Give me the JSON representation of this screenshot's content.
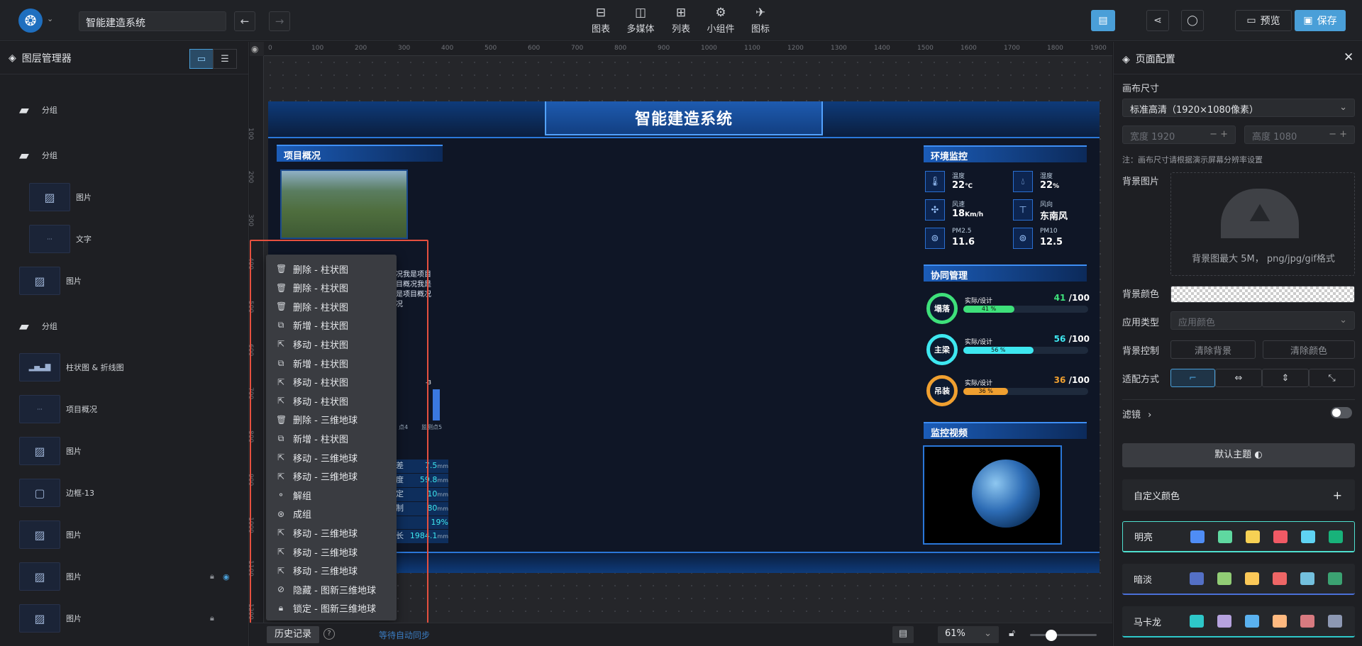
{
  "topbar": {
    "project_title": "智能建造系统",
    "back_icon": "←",
    "forward_icon": "→",
    "tools": [
      {
        "label": "图表",
        "icon": "chart-icon"
      },
      {
        "label": "多媒体",
        "icon": "media-icon"
      },
      {
        "label": "列表",
        "icon": "table-icon"
      },
      {
        "label": "小组件",
        "icon": "widget-icon"
      },
      {
        "label": "图标",
        "icon": "plane-icon"
      }
    ],
    "preview_label": "预览",
    "save_label": "保存",
    "accent": "#4a9fd8"
  },
  "layers_panel": {
    "title": "图层管理器",
    "items": [
      {
        "label": "分组",
        "type": "folder"
      },
      {
        "label": "分组",
        "type": "folder"
      },
      {
        "label": "图片",
        "type": "image"
      },
      {
        "label": "文字",
        "type": "text"
      },
      {
        "label": "图片",
        "type": "image"
      },
      {
        "label": "分组",
        "type": "folder"
      },
      {
        "label": "柱状图 & 折线图",
        "type": "chart"
      },
      {
        "label": "项目概况",
        "type": "text"
      },
      {
        "label": "图片",
        "type": "image"
      },
      {
        "label": "边框-13",
        "type": "border"
      },
      {
        "label": "图片",
        "type": "image"
      },
      {
        "label": "图片",
        "type": "image"
      },
      {
        "label": "图片",
        "type": "image"
      }
    ]
  },
  "ruler": {
    "h_ticks": [
      "0",
      "100",
      "200",
      "300",
      "400",
      "500",
      "600",
      "700",
      "800",
      "900",
      "1000",
      "1100",
      "1200",
      "1300",
      "1400",
      "1500",
      "1600",
      "1700",
      "1800",
      "1900"
    ],
    "v_ticks": [
      "100",
      "200",
      "300",
      "400",
      "500",
      "600",
      "700",
      "800",
      "900",
      "1000",
      "1100",
      "1200"
    ]
  },
  "dashboard": {
    "title": "智能建造系统",
    "project_panel": {
      "title": "项目概况",
      "text_lines": [
        "况我是项目",
        "目概况我是",
        "是项目概况",
        "况"
      ]
    },
    "env_panel": {
      "title": "环境监控",
      "items": [
        {
          "label": "温度",
          "value": "22",
          "unit": "℃",
          "icon": "thermometer-icon"
        },
        {
          "label": "湿度",
          "value": "22",
          "unit": "%",
          "icon": "droplet-icon"
        },
        {
          "label": "风速",
          "value": "18",
          "unit": "Km/h",
          "icon": "fan-icon"
        },
        {
          "label": "风向",
          "value": "东南风",
          "unit": "",
          "icon": "wind-direction-icon"
        },
        {
          "label": "PM2.5",
          "value": "11.6",
          "unit": "",
          "icon": "pm25-icon"
        },
        {
          "label": "PM10",
          "value": "12.5",
          "unit": "",
          "icon": "pm10-icon"
        }
      ]
    },
    "coop_panel": {
      "title": "协同管理",
      "items": [
        {
          "name": "塌落",
          "label": "实际/设计",
          "actual": "41",
          "total": "/100",
          "percent": 41,
          "pct_text": "41 %",
          "color": "#3ee07a"
        },
        {
          "name": "主梁",
          "label": "实际/设计",
          "actual": "56",
          "total": "/100",
          "percent": 56,
          "pct_text": "56 %",
          "color": "#3ee7f0"
        },
        {
          "name": "吊装",
          "label": "实际/设计",
          "actual": "36",
          "total": "/100",
          "percent": 36,
          "pct_text": "36 %",
          "color": "#f0a030"
        }
      ]
    },
    "video_panel": {
      "title": "监控视频"
    },
    "left_values": [
      "7.5",
      "59.8",
      "10",
      "80",
      "19%",
      "1984.1"
    ],
    "left_units": [
      "mm",
      "mm",
      "mm",
      "mm",
      "",
      "mm"
    ],
    "left_partial_labels": [
      "差",
      "度",
      "定",
      "制",
      "",
      "长"
    ],
    "chart_labels": [
      "-3",
      "点4",
      "监测点5"
    ]
  },
  "history": {
    "items": [
      {
        "label": "删除 - 柱状图",
        "icon": "trash-icon"
      },
      {
        "label": "删除 - 柱状图",
        "icon": "trash-icon"
      },
      {
        "label": "删除 - 柱状图",
        "icon": "trash-icon"
      },
      {
        "label": "新增 - 柱状图",
        "icon": "add-copy-icon"
      },
      {
        "label": "移动 - 柱状图",
        "icon": "move-icon"
      },
      {
        "label": "新增 - 柱状图",
        "icon": "add-copy-icon"
      },
      {
        "label": "移动 - 柱状图",
        "icon": "move-icon"
      },
      {
        "label": "移动 - 柱状图",
        "icon": "move-icon"
      },
      {
        "label": "删除 - 三维地球",
        "icon": "trash-icon"
      },
      {
        "label": "新增 - 柱状图",
        "icon": "add-copy-icon"
      },
      {
        "label": "移动 - 三维地球",
        "icon": "move-icon"
      },
      {
        "label": "移动 - 三维地球",
        "icon": "move-icon"
      },
      {
        "label": "解组",
        "icon": "ungroup-icon"
      },
      {
        "label": "成组",
        "icon": "group-icon"
      },
      {
        "label": "移动 - 三维地球",
        "icon": "move-icon"
      },
      {
        "label": "移动 - 三维地球",
        "icon": "move-icon"
      },
      {
        "label": "移动 - 三维地球",
        "icon": "move-icon"
      },
      {
        "label": "隐藏 - 图新三维地球",
        "icon": "eye-off-icon"
      },
      {
        "label": "锁定 - 图新三维地球",
        "icon": "lock-icon"
      }
    ],
    "button_label": "历史记录",
    "sync_text": "等待自动同步"
  },
  "bottom": {
    "zoom": "61%"
  },
  "page_config": {
    "title": "页面配置",
    "canvas_size_label": "画布尺寸",
    "canvas_size_value": "标准高清（1920×1080像素）",
    "width_label": "宽度",
    "width_value": "1920",
    "height_label": "高度",
    "height_value": "1080",
    "note": "注：画布尺寸请根据演示屏幕分辨率设置",
    "bg_image_label": "背景图片",
    "bg_image_hint": "背景图最大 5M， png/jpg/gif格式",
    "bg_color_label": "背景颜色",
    "app_type_label": "应用类型",
    "app_type_value": "应用颜色",
    "bg_control_label": "背景控制",
    "clear_bg": "清除背景",
    "clear_color": "清除颜色",
    "fit_label": "适配方式",
    "filter_label": "滤镜",
    "default_theme": "默认主题",
    "custom_color": "自定义颜色",
    "themes": [
      {
        "name": "明亮",
        "colors": [
          "#4f8df5",
          "#5fd8a0",
          "#f7d154",
          "#f05a65",
          "#5fd3f3",
          "#18b27a"
        ]
      },
      {
        "name": "暗淡",
        "colors": [
          "#5470c6",
          "#91cc75",
          "#fac858",
          "#ee6666",
          "#73c0de",
          "#3ba272"
        ]
      },
      {
        "name": "马卡龙",
        "colors": [
          "#2ec7c9",
          "#b6a2de",
          "#5ab1ef",
          "#ffb980",
          "#d87a80",
          "#8d98b3"
        ]
      }
    ]
  }
}
